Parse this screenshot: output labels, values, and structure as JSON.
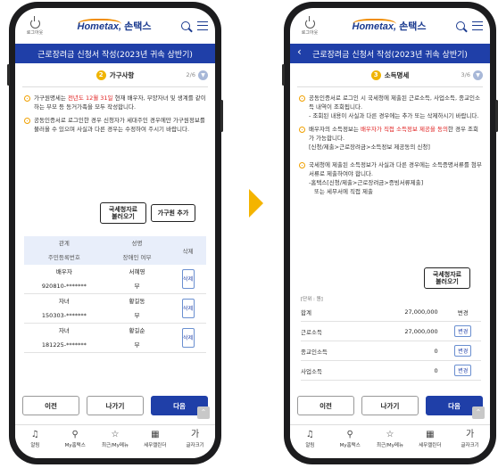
{
  "common": {
    "logout_label": "로그아웃",
    "brand_en": "Hometax,",
    "brand_ko": "손택스",
    "title": "근로장려금 신청서 작성(2023년 귀속 상반기)",
    "btn_prev": "이전",
    "btn_exit": "나가기",
    "btn_next": "다음",
    "nav": [
      {
        "icon": "bell-icon",
        "label": "알림"
      },
      {
        "icon": "person-icon",
        "label": "My홈택스"
      },
      {
        "icon": "star-icon",
        "label": "최근/My메뉴"
      },
      {
        "icon": "calendar-icon",
        "label": "세무캘린더"
      },
      {
        "icon": "font-size-icon",
        "label": "글자크기"
      }
    ]
  },
  "left": {
    "step_num": "2",
    "step_label": "가구사항",
    "step_page": "2/6",
    "note1_pre": "가구원명세는 ",
    "note1_red": "전년도 12월 31일",
    "note1_post": " 현재 배우자, 부양자녀 및 생계를 같이하는 부모 등 동거가족을 모두 작성합니다.",
    "note2": "공동인증서로 로그인한 경우 신청자가 세대주인 경우에만 가구원정보를 불러올 수 있으며 사실과 다른 경우는 수정하여 주시기 바랍니다.",
    "btn_load_line1": "국세청자료",
    "btn_load_line2": "불러오기",
    "btn_add": "가구원 추가",
    "table_headers": {
      "rel": "관계",
      "name": "성명",
      "del": "삭제",
      "rrn": "주민등록번호",
      "disabled": "장애인 여부"
    },
    "rows": [
      {
        "rel": "배우자",
        "name": "서혜영",
        "rrn": "920810-*******",
        "disabled": "부",
        "del": "삭제"
      },
      {
        "rel": "자녀",
        "name": "황길동",
        "rrn": "150303-*******",
        "disabled": "부",
        "del": "삭제"
      },
      {
        "rel": "자녀",
        "name": "황길순",
        "rrn": "181225-*******",
        "disabled": "부",
        "del": "삭제"
      }
    ]
  },
  "right": {
    "step_num": "3",
    "step_label": "소득명세",
    "step_page": "3/6",
    "note1_main": "공동인증서로 로그인 시 국세청에 제출된 근로소득, 사업소득, 종교인소득 내역이 조회됩니다.",
    "note1_sub": "- 조회된 내용이 사실과 다른 경우에는 추가 또는 삭제하시기 바랍니다.",
    "note2_pre": "배우자의 소득정보는 ",
    "note2_red": "배우자가 직접 소득정보 제공을 동의",
    "note2_post": "한 경우 조회가 가능합니다.",
    "note2_sub": "[신청/제출>근로장려금>소득정보 제공동의 신청]",
    "note3_main": "국세청에 제출된 소득정보가 사실과 다른 경우에는 소득증명서류를 첨부서류로 제출하여야 합니다.",
    "note3_sub1": "-홈택스[신청/제출>근로장려금>증빙서류제출]",
    "note3_sub2": "또는 세무서에 직접 제출",
    "btn_load_line1": "국세청자료",
    "btn_load_line2": "불러오기",
    "unit": "[단위 : 원]",
    "income": [
      {
        "label": "합계",
        "amount": "27,000,000",
        "action": "변경",
        "boxed": false
      },
      {
        "label": "근로소득",
        "amount": "27,000,000",
        "action": "변경",
        "boxed": true
      },
      {
        "label": "종교인소득",
        "amount": "0",
        "action": "변경",
        "boxed": true
      },
      {
        "label": "사업소득",
        "amount": "0",
        "action": "변경",
        "boxed": true
      }
    ]
  },
  "colors": {
    "primary": "#1f3fa8",
    "accent": "#f4b400",
    "red": "#e02020"
  }
}
